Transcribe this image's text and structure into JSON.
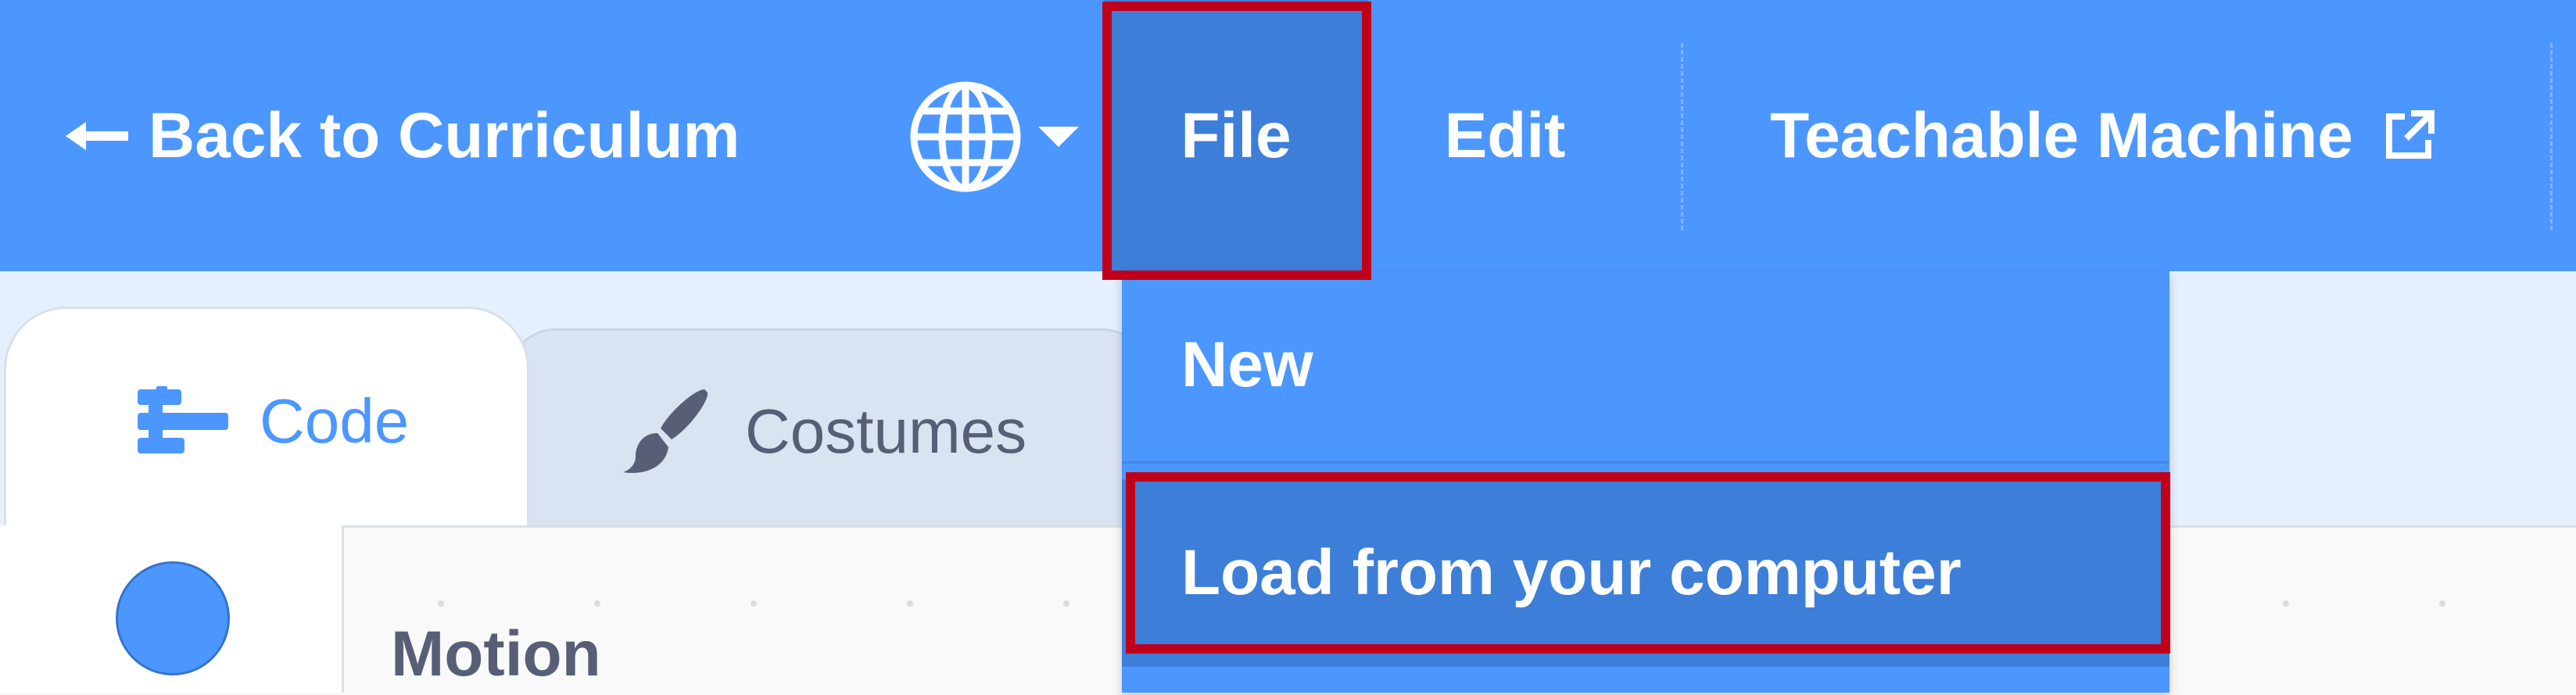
{
  "menubar": {
    "back_label": "Back to Curriculum",
    "language_icon": "globe-icon",
    "file_label": "File",
    "edit_label": "Edit",
    "teachable_label": "Teachable Machine",
    "external_icon": "external-link-icon"
  },
  "file_menu": {
    "items": [
      {
        "label": "New"
      },
      {
        "label": "Load from your computer"
      }
    ]
  },
  "tabs": {
    "code_label": "Code",
    "costumes_label": "Costumes"
  },
  "blocks": {
    "category_label": "Motion"
  },
  "colors": {
    "menubar": "#4c97ff",
    "menu_active": "#3d7ed9",
    "highlight": "#c0001a",
    "motion": "#4c97ff"
  }
}
